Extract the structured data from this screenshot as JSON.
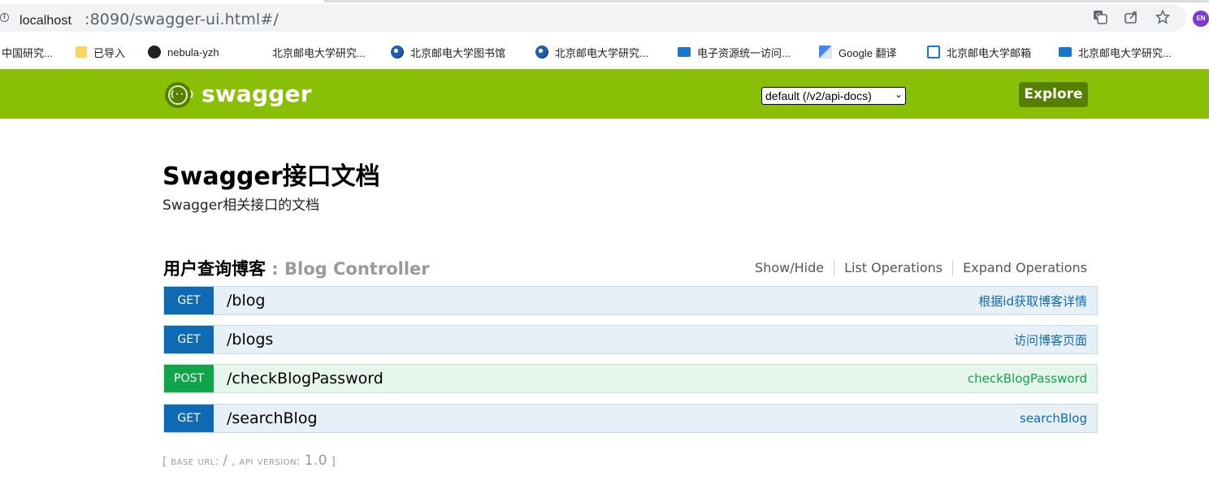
{
  "browser": {
    "url_host": "localhost",
    "url_rest": ":8090/swagger-ui.html#/",
    "profile_initials": "EN",
    "icons": [
      "info-icon",
      "translate-icon",
      "share-icon",
      "star-icon"
    ]
  },
  "bookmarks": [
    {
      "label": "中国研究...",
      "icon": "none"
    },
    {
      "label": "已导入",
      "icon": "folder-icon"
    },
    {
      "label": "nebula-yzh",
      "icon": "github-icon"
    },
    {
      "label": "北京邮电大学研究...",
      "icon": "none"
    },
    {
      "label": "北京邮电大学图书馆",
      "icon": "globe-icon"
    },
    {
      "label": "北京邮电大学研究...",
      "icon": "globe-icon"
    },
    {
      "label": "电子资源统一访问...",
      "icon": "library-icon"
    },
    {
      "label": "Google 翻译",
      "icon": "google-translate-icon"
    },
    {
      "label": "北京邮电大学邮箱",
      "icon": "mail-icon"
    },
    {
      "label": "北京邮电大学研究...",
      "icon": "library-icon"
    }
  ],
  "header": {
    "brand": "swagger",
    "logo_glyph": "{···}",
    "spec_select": "default (/v2/api-docs)",
    "explore_label": "Explore",
    "color": "#89bf04"
  },
  "info": {
    "title": "Swagger接口文档",
    "description": "Swagger相关接口的文档"
  },
  "resource": {
    "name": "用户查询博客",
    "separator": " : ",
    "controller": "Blog Controller",
    "options": [
      "Show/Hide",
      "List Operations",
      "Expand Operations"
    ]
  },
  "operations": [
    {
      "method": "GET",
      "path": "/blog",
      "summary": "根据id获取博客详情"
    },
    {
      "method": "GET",
      "path": "/blogs",
      "summary": "访问博客页面"
    },
    {
      "method": "POST",
      "path": "/checkBlogPassword",
      "summary": "checkBlogPassword"
    },
    {
      "method": "GET",
      "path": "/searchBlog",
      "summary": "searchBlog"
    }
  ],
  "footer": {
    "base_url_label": "base url",
    "base_url_value": "/",
    "api_version_label": "api version",
    "api_version_value": "1.0"
  }
}
